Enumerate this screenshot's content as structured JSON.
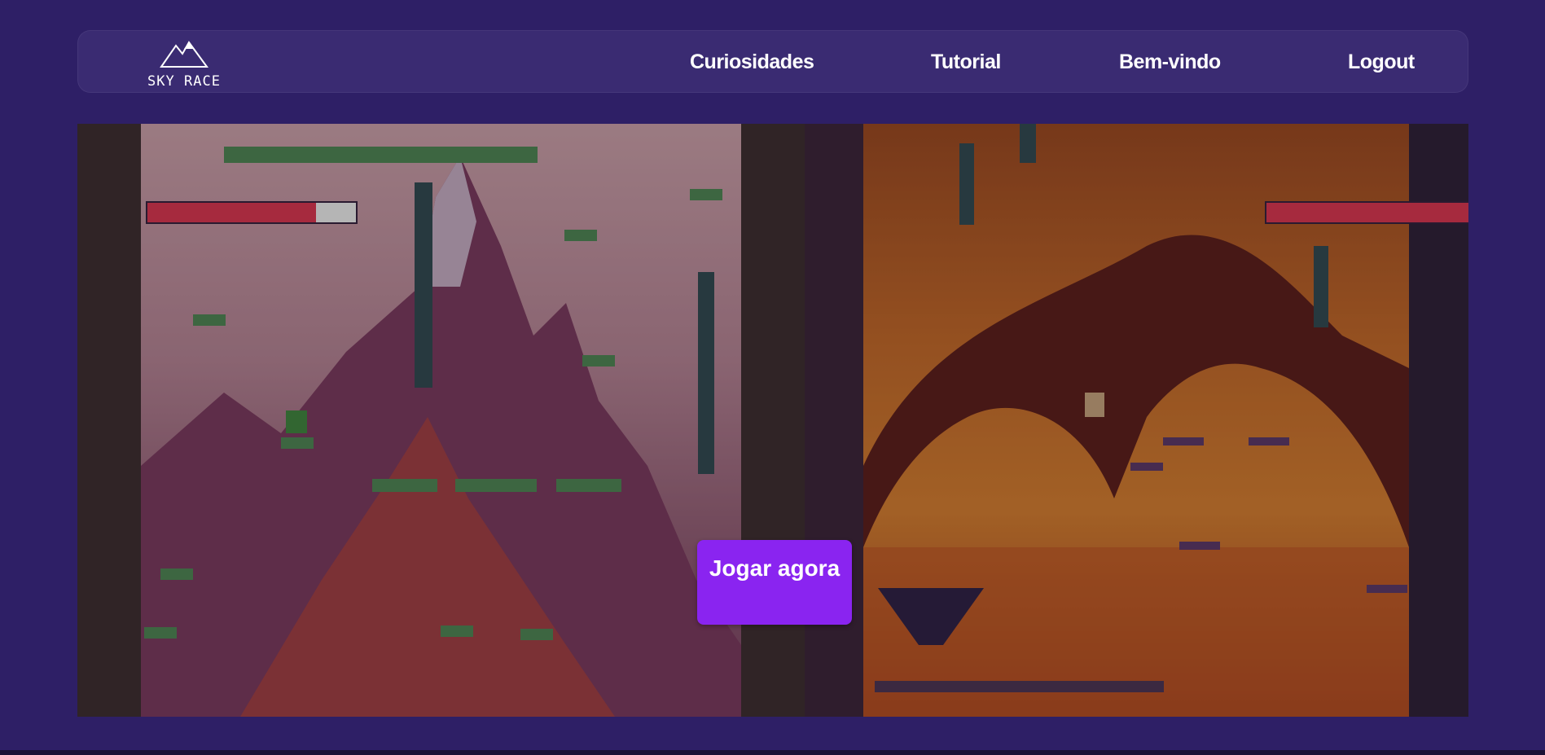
{
  "brand": {
    "name": "SKY RACE",
    "logo_icon": "mountain-icon"
  },
  "nav": {
    "links": [
      {
        "label": "Curiosidades"
      },
      {
        "label": "Tutorial"
      },
      {
        "label": "Bem-vindo"
      },
      {
        "label": "Logout"
      }
    ]
  },
  "game": {
    "player1": {
      "level": "mountain",
      "health_fraction": 0.81
    },
    "player2": {
      "level": "lava-cave",
      "health_fraction": 0.98
    },
    "play_button": {
      "label": "Jogar agora"
    }
  },
  "colors": {
    "background": "#2e1f66",
    "navbar": "#3a2b72",
    "accent_button": "#8a24f0",
    "health_bar": "#a62a3e"
  }
}
